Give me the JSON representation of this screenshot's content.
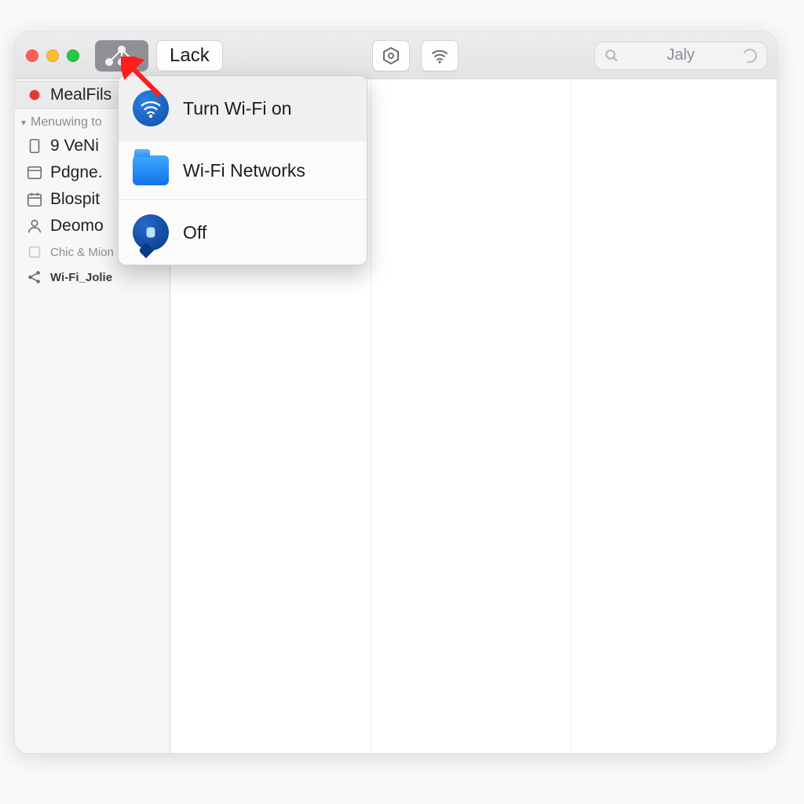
{
  "toolbar": {
    "title_button_label": "Lack",
    "search_placeholder": "Jaly"
  },
  "sidebar": {
    "highlighted_item": "MealFils",
    "section_header": "Menuwing to",
    "items": [
      {
        "label": "9 VeNi"
      },
      {
        "label": "Pdgne."
      },
      {
        "label": "Blospit"
      },
      {
        "label": "Deomo"
      }
    ],
    "tags": [
      {
        "label": "Chic & Mion"
      },
      {
        "label": "Wi-Fi_Jolie"
      }
    ]
  },
  "menu": {
    "items": [
      {
        "label": "Turn Wi-Fi on"
      },
      {
        "label": "Wi-Fi Networks"
      },
      {
        "label": "Off"
      }
    ]
  }
}
